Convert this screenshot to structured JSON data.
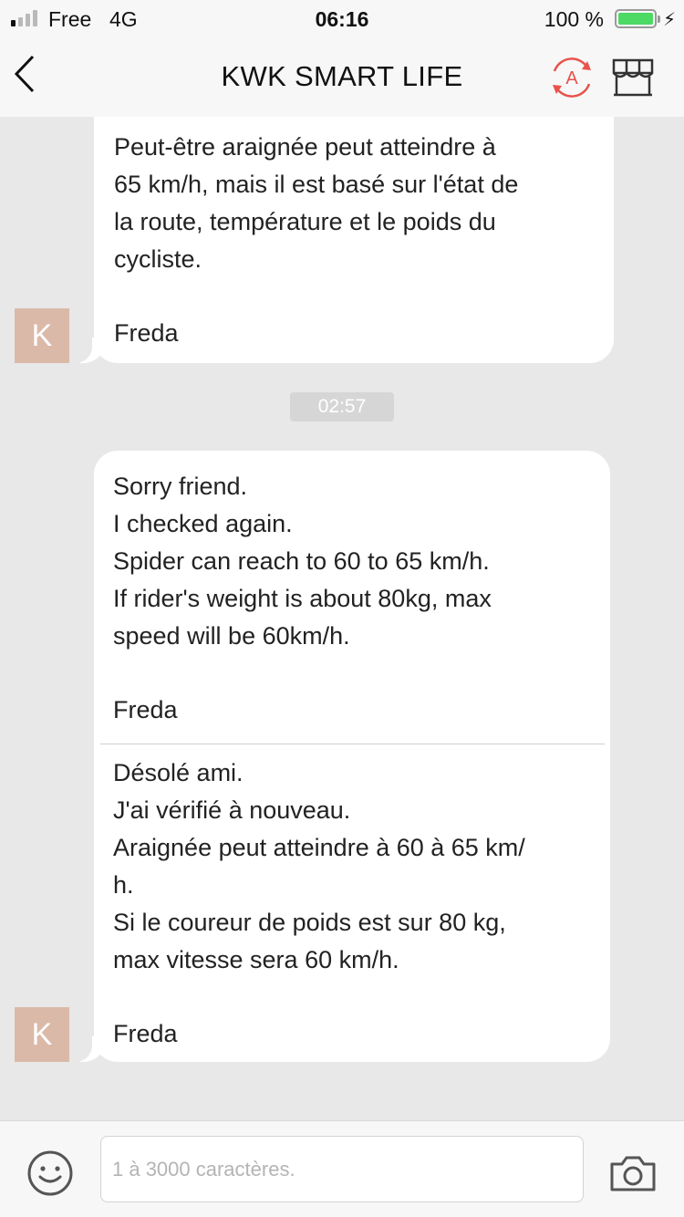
{
  "status_bar": {
    "carrier": "Free",
    "network": "4G",
    "time": "06:16",
    "battery": "100 %",
    "battery_level": 1.0,
    "signal_bars": [
      true,
      false,
      false,
      false
    ],
    "icons": [
      "signal-icon",
      "battery-icon",
      "charging-icon"
    ]
  },
  "nav": {
    "title": "KWK SMART LIFE",
    "icons": [
      "back-chevron-icon",
      "translate-icon",
      "shop-icon"
    ],
    "accent_color": "#e8524a"
  },
  "messages": [
    {
      "sender_avatar": "K",
      "lines": [
        "Peut-être araignée peut atteindre à",
        "65 km/h, mais il est basé sur l'état de",
        "la route, température et le poids du",
        "cycliste."
      ],
      "signature": "Freda"
    },
    {
      "timestamp": "02:57",
      "sender_avatar": "K",
      "lines": [
        "Sorry friend.",
        "I checked again.",
        "Spider can reach to 60 to 65 km/h.",
        "If rider's weight is about 80kg, max",
        "speed will be 60km/h."
      ],
      "signature": "Freda",
      "translation": {
        "lines": [
          "Désolé ami.",
          "J'ai vérifié à nouveau.",
          "Araignée peut atteindre à 60 à 65 km/",
          "h.",
          "Si le coureur de poids est sur 80 kg,",
          "max vitesse sera 60 km/h."
        ],
        "signature": "Freda"
      }
    }
  ],
  "composer": {
    "placeholder": "1 à 3000 caractères.",
    "value": "",
    "icons": [
      "emoji-icon",
      "camera-icon"
    ]
  },
  "colors": {
    "background": "#e8e8e8",
    "avatar": "#dbb9a9",
    "battery_fill": "#4cd964"
  }
}
